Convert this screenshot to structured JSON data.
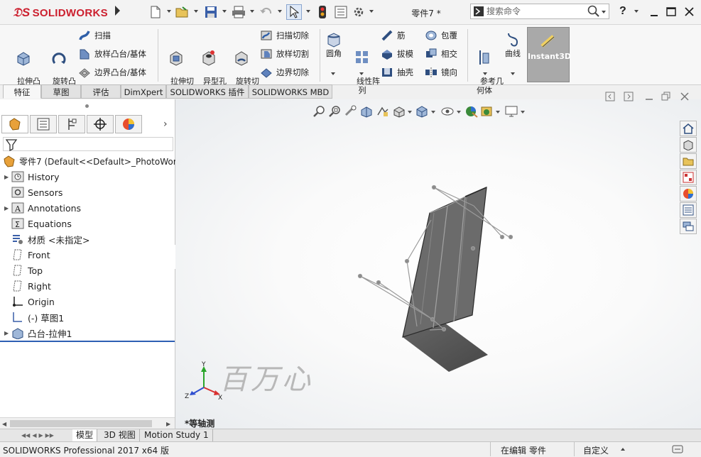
{
  "app": {
    "brand": "SOLIDWORKS",
    "document_title": "零件7 *",
    "brand_color": "#cc1f2e"
  },
  "search": {
    "placeholder": "搜索命令"
  },
  "window_controls": {
    "help": "?"
  },
  "ribbon": {
    "extrude_boss": "拉伸凸\n台/基体",
    "revolve_boss": "旋转凸\n台/基体",
    "sweep": "扫描",
    "loft_boss": "放样凸台/基体",
    "boundary_boss": "边界凸台/基体",
    "extrude_cut": "拉伸切\n除",
    "hole_wizard": "异型孔\n向导",
    "revolve_cut": "旋转切\n除",
    "swept_cut": "扫描切除",
    "lofted_cut": "放样切割",
    "boundary_cut": "边界切除",
    "fillet": "圆角",
    "linear_pattern": "线性阵\n列",
    "rib": "筋",
    "draft": "拔模",
    "shell": "抽壳",
    "wrap": "包覆",
    "intersect": "相交",
    "mirror": "镜向",
    "reference_geometry": "参考几\n何体",
    "curves": "曲线",
    "instant3d": "Instant3D"
  },
  "command_tabs": [
    "特征",
    "草图",
    "评估",
    "DimXpert",
    "SOLIDWORKS 插件",
    "SOLIDWORKS MBD"
  ],
  "tree": {
    "root": "零件7  (Default<<Default>_PhotoWorl",
    "items": [
      "History",
      "Sensors",
      "Annotations",
      "Equations",
      "材质 <未指定>",
      "Front",
      "Top",
      "Right",
      "Origin",
      "(-) 草图1",
      "凸台-拉伸1"
    ]
  },
  "viewport": {
    "view_name": "*等轴测",
    "watermark": "百万心",
    "triad": {
      "x": "X",
      "y": "Y",
      "z": "Z"
    }
  },
  "bottom_tabs": [
    "模型",
    "3D 视图",
    "Motion Study 1"
  ],
  "status": {
    "product": "SOLIDWORKS Professional 2017 x64 版",
    "editing": "在编辑 零件",
    "units": "自定义"
  }
}
